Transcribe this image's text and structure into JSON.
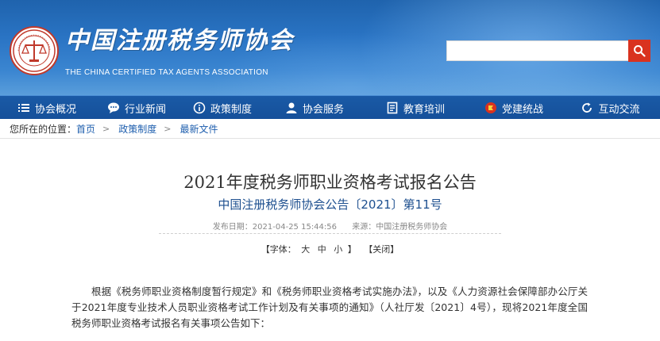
{
  "header": {
    "title": "中国注册税务师协会",
    "subtitle": "THE CHINA CERTIFIED TAX AGENTS ASSOCIATION",
    "search_placeholder": "",
    "colors": {
      "primary": "#1f63ad",
      "search_button": "#d9321f"
    }
  },
  "nav": {
    "items": [
      {
        "label": "协会概况",
        "icon": "menu-icon"
      },
      {
        "label": "行业新闻",
        "icon": "chat-icon"
      },
      {
        "label": "政策制度",
        "icon": "info-icon"
      },
      {
        "label": "协会服务",
        "icon": "user-icon"
      },
      {
        "label": "教育培训",
        "icon": "book-icon"
      },
      {
        "label": "党建统战",
        "icon": "flag-icon"
      },
      {
        "label": "互动交流",
        "icon": "refresh-icon"
      }
    ]
  },
  "breadcrumb": {
    "prefix": "您所在的位置：",
    "items": [
      "首页",
      "政策制度",
      "最新文件"
    ]
  },
  "article": {
    "title": "2021年度税务师职业资格考试报名公告",
    "subtitle": "中国注册税务师协会公告〔2021〕第11号",
    "publish_label": "发布日期：",
    "publish_date": "2021-04-25 15:44:56",
    "source_label": "来源：",
    "source": "中国注册税务师协会",
    "font_label": "【字体：",
    "font_large": "大",
    "font_medium": "中",
    "font_small": "小",
    "font_end": "】",
    "close_label": "【关闭】",
    "body": "根据《税务师职业资格制度暂行规定》和《税务师职业资格考试实施办法》，以及《人力资源社会保障部办公厅关于2021年度专业技术人员职业资格考试工作计划及有关事项的通知》（人社厅发〔2021〕4号），现将2021年度全国税务师职业资格考试报名有关事项公告如下："
  }
}
